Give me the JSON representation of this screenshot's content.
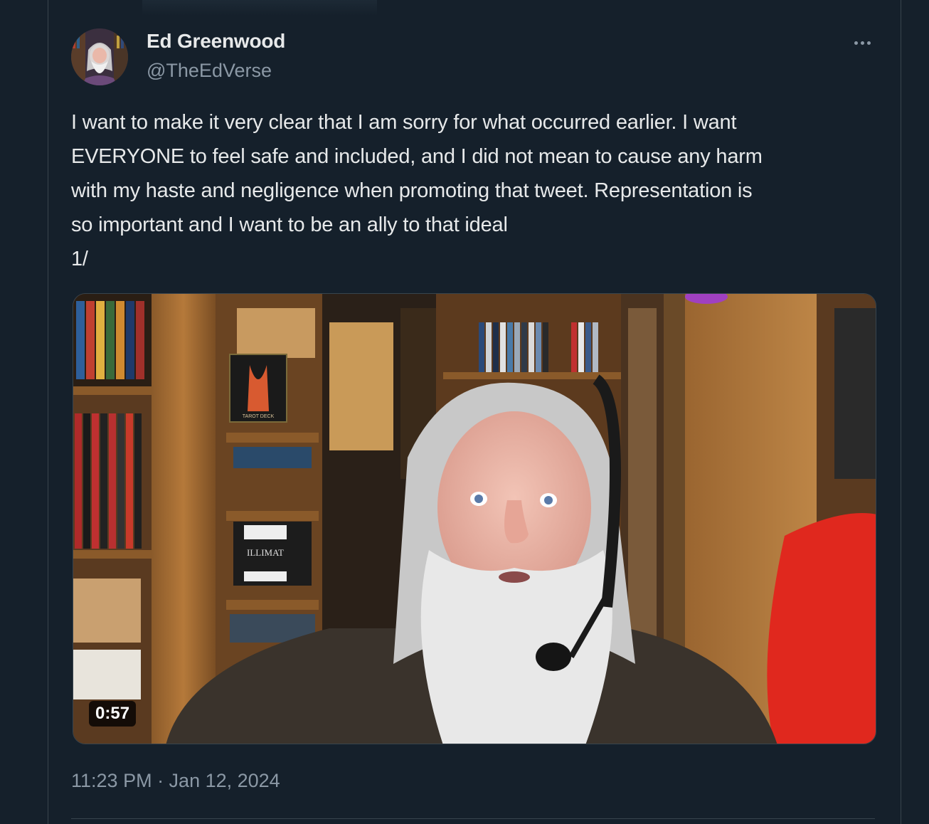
{
  "author": {
    "display_name": "Ed Greenwood",
    "handle": "@TheEdVerse"
  },
  "tweet": {
    "text": "I want to make it very clear that I am sorry for what occurred earlier. I want\nEVERYONE to feel safe and included, and I did not mean to cause any harm\nwith my haste and negligence when promoting that tweet. Representation is\nso important and I want to be an ally to that ideal\n1/",
    "timestamp": "11:23 PM · Jan 12, 2024"
  },
  "video": {
    "duration": "0:57",
    "box_label": "ILLIMAT",
    "tarot_label": "TAROT DECK"
  },
  "icons": {
    "more": "more-horizontal-icon"
  },
  "colors": {
    "background": "#15202b",
    "text_primary": "#e7e9ea",
    "text_secondary": "#8b98a5",
    "border": "#38444d"
  }
}
